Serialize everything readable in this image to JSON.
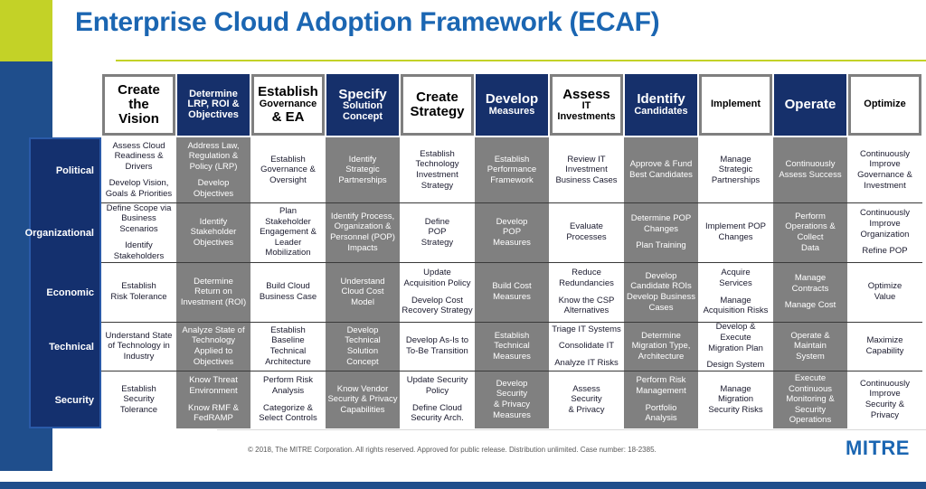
{
  "header": {
    "title": "Enterprise Cloud Adoption Framework (ECAF)"
  },
  "footer": {
    "copyright": "© 2018, The MITRE Corporation. All rights reserved. Approved for public release. Distribution unlimited. Case number: 18-2385.",
    "logo": "MITRE"
  },
  "colors": {
    "accent_green": "#c3d227",
    "brand_blue": "#1b66b2",
    "dark_navy": "#16306b",
    "rail_navy": "#14306e",
    "cell_gray": "#808080"
  },
  "matrix": {
    "phases": [
      {
        "lines": [
          "Create",
          "the",
          "Vision"
        ],
        "style": "light",
        "weights": [
          "l1",
          "l1",
          "l1"
        ]
      },
      {
        "lines": [
          "Determine",
          "LRP, ROI &",
          "Objectives"
        ],
        "style": "dark",
        "weights": [
          "l2",
          "l2",
          "l2"
        ]
      },
      {
        "lines": [
          "Establish",
          "Governance",
          "& EA"
        ],
        "style": "light",
        "weights": [
          "l1",
          "l2",
          "l1"
        ]
      },
      {
        "lines": [
          "Specify",
          "Solution",
          "Concept"
        ],
        "style": "dark",
        "weights": [
          "l1",
          "l2",
          "l2"
        ]
      },
      {
        "lines": [
          "Create",
          "Strategy"
        ],
        "style": "light",
        "weights": [
          "l1",
          "l1"
        ]
      },
      {
        "lines": [
          "Develop",
          "Measures"
        ],
        "style": "dark",
        "weights": [
          "l1",
          "l2"
        ]
      },
      {
        "lines": [
          "Assess",
          "IT",
          "Investments"
        ],
        "style": "light",
        "weights": [
          "l1",
          "l2",
          "l2"
        ]
      },
      {
        "lines": [
          "Identify",
          "Candidates"
        ],
        "style": "dark",
        "weights": [
          "l1",
          "l2"
        ]
      },
      {
        "lines": [
          "Implement"
        ],
        "style": "light",
        "weights": [
          "l2"
        ]
      },
      {
        "lines": [
          "Operate"
        ],
        "style": "dark",
        "weights": [
          "l1"
        ]
      },
      {
        "lines": [
          "Optimize"
        ],
        "style": "light",
        "weights": [
          "l2"
        ]
      }
    ],
    "rows": [
      {
        "label": "Political"
      },
      {
        "label": "Organizational"
      },
      {
        "label": "Economic"
      },
      {
        "label": "Technical"
      },
      {
        "label": "Security"
      }
    ],
    "cells": [
      [
        {
          "groups": [
            [
              "Assess Cloud",
              "Readiness &",
              "Drivers"
            ],
            [
              "Develop Vision,",
              "Goals & Priorities"
            ]
          ]
        },
        {
          "groups": [
            [
              "Address Law,",
              "Regulation &",
              "Policy (LRP)"
            ],
            [
              "Develop",
              "Objectives"
            ]
          ]
        },
        {
          "groups": [
            [
              "Establish",
              "Governance &",
              "Oversight"
            ]
          ]
        },
        {
          "groups": [
            [
              "Identify",
              "Strategic",
              "Partnerships"
            ]
          ]
        },
        {
          "groups": [
            [
              "Establish",
              "Technology",
              "Investment",
              "Strategy"
            ]
          ]
        },
        {
          "groups": [
            [
              "Establish",
              "Performance",
              "Framework"
            ]
          ]
        },
        {
          "groups": [
            [
              "Review IT",
              "Investment",
              "Business Cases"
            ]
          ]
        },
        {
          "groups": [
            [
              "Approve & Fund",
              "Best Candidates"
            ]
          ]
        },
        {
          "groups": [
            [
              "Manage",
              "Strategic",
              "Partnerships"
            ]
          ]
        },
        {
          "groups": [
            [
              "Continuously",
              "Assess Success"
            ]
          ]
        },
        {
          "groups": [
            [
              "Continuously",
              "Improve",
              "Governance &",
              "Investment"
            ]
          ]
        }
      ],
      [
        {
          "groups": [
            [
              "Define Scope via",
              "Business Scenarios"
            ],
            [
              "Identify",
              "Stakeholders"
            ]
          ]
        },
        {
          "groups": [
            [
              "Identify",
              "Stakeholder",
              "Objectives"
            ]
          ]
        },
        {
          "groups": [
            [
              "Plan",
              "Stakeholder",
              "Engagement &",
              "Leader",
              "Mobilization"
            ]
          ]
        },
        {
          "groups": [
            [
              "Identify Process,",
              "Organization &",
              "Personnel (POP)",
              "Impacts"
            ]
          ]
        },
        {
          "groups": [
            [
              "Define",
              "POP",
              "Strategy"
            ]
          ]
        },
        {
          "groups": [
            [
              "Develop",
              "POP",
              "Measures"
            ]
          ]
        },
        {
          "groups": [
            [
              "Evaluate",
              "Processes"
            ]
          ]
        },
        {
          "groups": [
            [
              "Determine  POP",
              "Changes"
            ],
            [
              "Plan Training"
            ]
          ]
        },
        {
          "groups": [
            [
              "Implement POP",
              "Changes"
            ]
          ]
        },
        {
          "groups": [
            [
              "Perform",
              "Operations &",
              "Collect",
              "Data"
            ]
          ]
        },
        {
          "groups": [
            [
              "Continuously",
              "Improve",
              "Organization"
            ],
            [
              "Refine POP"
            ]
          ]
        }
      ],
      [
        {
          "groups": [
            [
              "Establish",
              "Risk Tolerance"
            ]
          ]
        },
        {
          "groups": [
            [
              "Determine",
              "Return on",
              "Investment (ROI)"
            ]
          ]
        },
        {
          "groups": [
            [
              "Build Cloud",
              "Business Case"
            ]
          ]
        },
        {
          "groups": [
            [
              "Understand",
              "Cloud Cost",
              "Model"
            ]
          ]
        },
        {
          "groups": [
            [
              "Update",
              "Acquisition Policy"
            ],
            [
              "Develop Cost",
              "Recovery Strategy"
            ]
          ]
        },
        {
          "groups": [
            [
              "Build Cost",
              "Measures"
            ]
          ]
        },
        {
          "groups": [
            [
              "Reduce",
              "Redundancies"
            ],
            [
              "Know the CSP",
              "Alternatives"
            ]
          ]
        },
        {
          "groups": [
            [
              "Develop",
              "Candidate ROIs",
              "Develop Business",
              "Cases"
            ]
          ]
        },
        {
          "groups": [
            [
              "Acquire",
              "Services"
            ],
            [
              "Manage",
              "Acquisition Risks"
            ]
          ]
        },
        {
          "groups": [
            [
              "Manage",
              "Contracts"
            ],
            [
              "Manage Cost"
            ]
          ]
        },
        {
          "groups": [
            [
              "Optimize",
              "Value"
            ]
          ]
        }
      ],
      [
        {
          "groups": [
            [
              "Understand State",
              "of Technology in",
              "Industry"
            ]
          ]
        },
        {
          "groups": [
            [
              "Analyze State of",
              "Technology",
              "Applied to",
              "Objectives"
            ]
          ]
        },
        {
          "groups": [
            [
              "Establish",
              "Baseline",
              "Technical",
              "Architecture"
            ]
          ]
        },
        {
          "groups": [
            [
              "Develop",
              "Technical",
              "Solution",
              "Concept"
            ]
          ]
        },
        {
          "groups": [
            [
              "Develop As-Is to",
              "To-Be Transition"
            ]
          ]
        },
        {
          "groups": [
            [
              "Establish",
              "Technical",
              "Measures"
            ]
          ]
        },
        {
          "groups": [
            [
              "Triage IT Systems"
            ],
            [
              "Consolidate IT"
            ],
            [
              "Analyze IT Risks"
            ]
          ]
        },
        {
          "groups": [
            [
              "Determine",
              "Migration Type,",
              "Architecture"
            ]
          ]
        },
        {
          "groups": [
            [
              "Develop & Execute",
              "Migration Plan"
            ],
            [
              "Design System"
            ]
          ]
        },
        {
          "groups": [
            [
              "Operate &",
              "Maintain",
              "System"
            ]
          ]
        },
        {
          "groups": [
            [
              "Maximize",
              "Capability"
            ]
          ]
        }
      ],
      [
        {
          "groups": [
            [
              "Establish",
              "Security",
              "Tolerance"
            ]
          ]
        },
        {
          "groups": [
            [
              "Know  Threat",
              "Environment"
            ],
            [
              "Know RMF &",
              "FedRAMP"
            ]
          ]
        },
        {
          "groups": [
            [
              "Perform Risk",
              "Analysis"
            ],
            [
              "Categorize &",
              "Select Controls"
            ]
          ]
        },
        {
          "groups": [
            [
              "Know Vendor",
              "Security & Privacy",
              "Capabilities"
            ]
          ]
        },
        {
          "groups": [
            [
              "Update Security",
              "Policy"
            ],
            [
              "Define Cloud",
              "Security Arch."
            ]
          ]
        },
        {
          "groups": [
            [
              "Develop",
              "Security",
              "& Privacy",
              "Measures"
            ]
          ]
        },
        {
          "groups": [
            [
              "Assess",
              "Security",
              "& Privacy"
            ]
          ]
        },
        {
          "groups": [
            [
              "Perform Risk",
              "Management"
            ],
            [
              "Portfolio",
              "Analysis"
            ]
          ]
        },
        {
          "groups": [
            [
              "Manage",
              "Migration",
              "Security Risks"
            ]
          ]
        },
        {
          "groups": [
            [
              "Execute",
              "Continuous",
              "Monitoring &",
              "Security",
              "Operations"
            ]
          ]
        },
        {
          "groups": [
            [
              "Continuously",
              "Improve",
              "Security &",
              "Privacy"
            ]
          ]
        }
      ]
    ]
  }
}
